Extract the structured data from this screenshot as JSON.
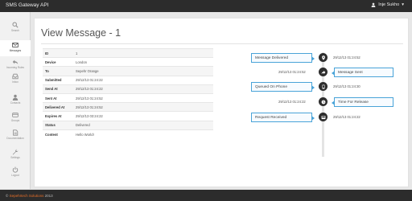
{
  "app": {
    "title": "SMS Gateway API",
    "user_name": "Inje Sukho"
  },
  "sidebar": {
    "items": [
      {
        "label": "Search",
        "icon": "search-icon"
      },
      {
        "label": "Messages",
        "icon": "envelope-icon",
        "active": true
      },
      {
        "label": "Incoming Rules",
        "icon": "reply-icon"
      },
      {
        "label": "Inbox",
        "icon": "inbox-icon"
      },
      {
        "label": "Contacts",
        "icon": "user-icon"
      },
      {
        "label": "Groups",
        "icon": "credit-card-icon"
      },
      {
        "label": "Documentation",
        "icon": "document-icon"
      },
      {
        "label": "Settings",
        "icon": "wrench-icon"
      },
      {
        "label": "Logout",
        "icon": "power-icon"
      }
    ]
  },
  "page": {
    "title": "View Message - 1"
  },
  "details": [
    {
      "key": "ID",
      "value": "1"
    },
    {
      "key": "Device",
      "value": "London"
    },
    {
      "key": "To",
      "value": "Sepehr Orange"
    },
    {
      "key": "Submitted",
      "value": "29/12/13 01:24:22"
    },
    {
      "key": "Send At",
      "value": "29/12/13 01:24:22"
    },
    {
      "key": "Sent At",
      "value": "29/12/13 01:24:52"
    },
    {
      "key": "Delivered At",
      "value": "29/12/13 01:24:52"
    },
    {
      "key": "Expires At",
      "value": "29/12/13 03:24:22"
    },
    {
      "key": "Status",
      "value": "Delivered"
    },
    {
      "key": "Content",
      "value": "Hello World!"
    }
  ],
  "timeline": [
    {
      "label": "Message Delivered",
      "time": "29/12/13 01:24:52",
      "side": "left",
      "icon": "location-pin-icon"
    },
    {
      "label": "Message Sent",
      "time": "29/12/13 01:24:52",
      "side": "right",
      "icon": "send-arrow-icon"
    },
    {
      "label": "Queued On Phone",
      "time": "29/12/13 01:24:30",
      "side": "left",
      "icon": "phone-icon"
    },
    {
      "label": "Time For Release",
      "time": "29/12/13 01:24:22",
      "side": "right",
      "icon": "clock-icon"
    },
    {
      "label": "Request Received",
      "time": "29/12/13 01:24:22",
      "side": "left",
      "icon": "inbox-tray-icon"
    }
  ],
  "footer": {
    "copyright": "©",
    "company": "Sepehrtech Solutions",
    "year": "2013"
  },
  "colors": {
    "accent": "#49a3d8",
    "topbar": "#2c2c2c",
    "footer_accent": "#e8702a"
  }
}
